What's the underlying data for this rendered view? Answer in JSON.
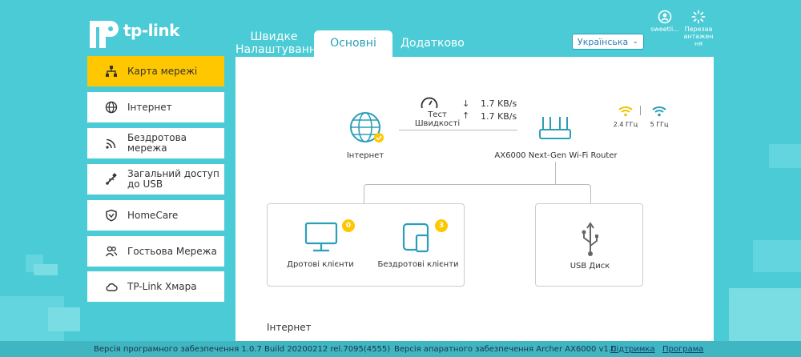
{
  "logo": {
    "text": "tp-link"
  },
  "tabs": [
    {
      "label": "Швидке Налаштування"
    },
    {
      "label": "Основні"
    },
    {
      "label": "Додатково"
    }
  ],
  "language": {
    "selected": "Українська"
  },
  "top_actions": {
    "user_label": "sweetli...",
    "reboot_label": "Перезав антажен ня"
  },
  "sidebar": {
    "items": [
      {
        "label": "Карта мережі",
        "icon": "network-map-icon",
        "active": true
      },
      {
        "label": "Інтернет",
        "icon": "globe-icon"
      },
      {
        "label": "Бездротова мережа",
        "icon": "wireless-icon"
      },
      {
        "label": "Загальний доступ до USB",
        "icon": "usb-icon"
      },
      {
        "label": "HomeCare",
        "icon": "shield-icon"
      },
      {
        "label": "Гостьова Мережа",
        "icon": "guest-users-icon"
      },
      {
        "label": "TP-Link Хмара",
        "icon": "cloud-icon"
      }
    ]
  },
  "map": {
    "internet_label": "Інтернет",
    "speed_test_label": "Тест Швидкості",
    "download_speed": "1.7 KB/s",
    "upload_speed": "1.7 KB/s",
    "router_label": "AX6000 Next-Gen Wi-Fi Router",
    "band_24": "2.4 ГГц",
    "band_5": "5 ГГц",
    "wired_clients_label": "Дротові клієнти",
    "wired_clients_count": "0",
    "wireless_clients_label": "Бездротові клієнти",
    "wireless_clients_count": "3",
    "usb_disk_label": "USB Диск"
  },
  "section": {
    "internet_title": "Інтернет"
  },
  "footer": {
    "firmware": "Версія програмного забезпечення 1.0.7 Build 20200212 rel.7095(4555)",
    "hardware": "Версія апаратного забезпечення Archer AX6000 v1.0",
    "support_link": "Підтримка",
    "app_link": "Програма"
  },
  "colors": {
    "background": "#4acbd6",
    "accent_yellow": "#ffc700",
    "accent_blue": "#2a9fb8",
    "wifi_24": "#f2c200",
    "wifi_5": "#2a9fb8"
  }
}
